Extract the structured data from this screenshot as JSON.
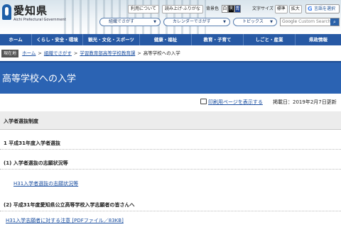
{
  "header": {
    "logo_name": "愛知県",
    "logo_sub": "Aichi Prefectural Government",
    "util": {
      "usage": "利用について",
      "reading": "読み上げ·ふりがな",
      "bg_label": "背景色",
      "bg_white": "白",
      "bg_black": "黒",
      "bg_blue": "青",
      "font_label": "文字サイズ",
      "font_normal": "標準",
      "font_large": "拡大",
      "lang_button": "言語を選択"
    },
    "pills": {
      "org": "組織でさがす",
      "calendar": "カレンダーでさがす",
      "topics": "トピックス"
    },
    "search_placeholder": "Custom Search",
    "search_prefix": "Google"
  },
  "nav": [
    {
      "label": "ホーム"
    },
    {
      "label": "くらし・安全・環境"
    },
    {
      "label": "観光・文化・スポーツ"
    },
    {
      "label": "健康・福祉"
    },
    {
      "label": "教育・子育て"
    },
    {
      "label": "しごと・産業"
    },
    {
      "label": "県政情報"
    }
  ],
  "breadcrumb": {
    "here_label": "現在地",
    "items": [
      "ホーム",
      "組織でさがす",
      "学習教育部高等学校教育課",
      "高等学校への入学"
    ]
  },
  "page": {
    "title": "高等学校への入学",
    "print_label": "印刷用ページを表示する",
    "published": "掲載日：2019年2月7日更新"
  },
  "sections": {
    "main": "入学者選抜制度",
    "s1": "1 平成31年度入学者選抜",
    "s1_1": "(1) 入学者選抜の志願状況等",
    "s1_1_link": "H31入学者選抜の志願状況等",
    "s1_2": "(2) 平成31年度愛知県公立高等学校入学志願者の皆さんへ",
    "s1_2_link": "H31入学志願者に対する注意 [PDFファイル／83KB]"
  },
  "colors": {
    "nav_bg": "#2759a4",
    "title_bg": "#2b63b3",
    "link": "#1a4ea0"
  }
}
